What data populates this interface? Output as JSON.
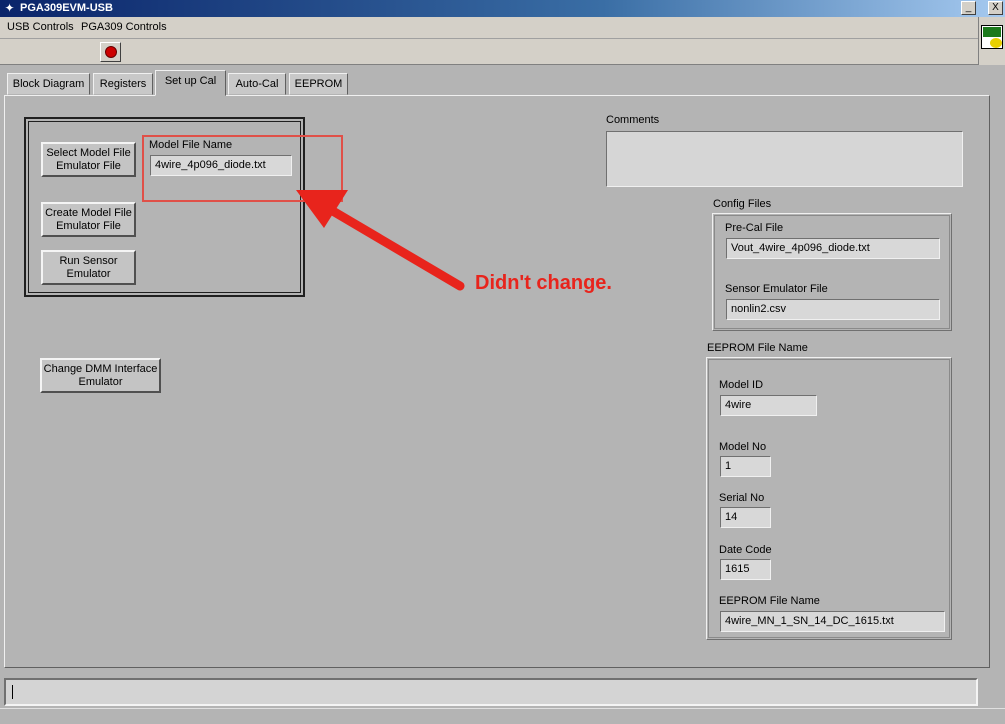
{
  "window": {
    "title": "PGA309EVM-USB",
    "min": "_",
    "close": "X"
  },
  "menu": [
    "USB Controls",
    "PGA309 Controls"
  ],
  "tabs": [
    "Block Diagram",
    "Registers",
    "Set up Cal",
    "Auto-Cal",
    "EEPROM"
  ],
  "setup": {
    "select_model_button": "Select Model File\nEmulator File",
    "create_model_button": "Create Model File\nEmulator File",
    "run_sensor_button": "Run Sensor\nEmulator",
    "model_file_label": "Model File Name",
    "model_file_value": "4wire_4p096_diode.txt",
    "change_dmm_button": "Change DMM Interface\nEmulator"
  },
  "annotation": {
    "text": "Didn't change.",
    "color": "#e8241c"
  },
  "comments": {
    "label": "Comments",
    "value": ""
  },
  "config_files": {
    "label": "Config Files",
    "precal_label": "Pre-Cal File",
    "precal_value": "Vout_4wire_4p096_diode.txt",
    "sensor_label": "Sensor Emulator File",
    "sensor_value": "nonlin2.csv"
  },
  "eeprom": {
    "label": "EEPROM File Name",
    "model_id_label": "Model ID",
    "model_id_value": "4wire",
    "model_no_label": "Model No",
    "model_no_value": "1",
    "serial_no_label": "Serial No",
    "serial_no_value": "14",
    "date_code_label": "Date Code",
    "date_code_value": "1615",
    "file_name_label": "EEPROM File Name",
    "file_name_value": "4wire_MN_1_SN_14_DC_1615.txt"
  },
  "status": {
    "value": ""
  }
}
